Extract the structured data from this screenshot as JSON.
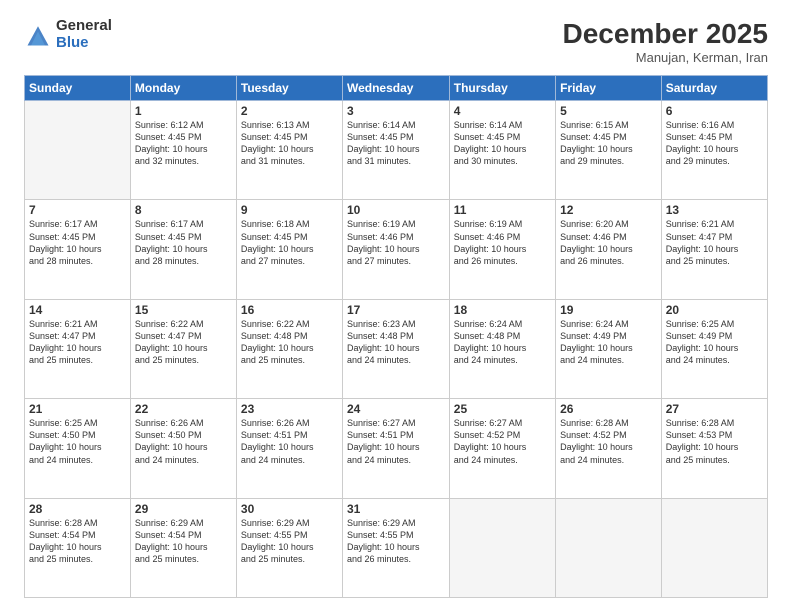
{
  "header": {
    "logo_general": "General",
    "logo_blue": "Blue",
    "month_year": "December 2025",
    "location": "Manujan, Kerman, Iran"
  },
  "days_of_week": [
    "Sunday",
    "Monday",
    "Tuesday",
    "Wednesday",
    "Thursday",
    "Friday",
    "Saturday"
  ],
  "weeks": [
    [
      {
        "num": "",
        "info": ""
      },
      {
        "num": "1",
        "info": "Sunrise: 6:12 AM\nSunset: 4:45 PM\nDaylight: 10 hours\nand 32 minutes."
      },
      {
        "num": "2",
        "info": "Sunrise: 6:13 AM\nSunset: 4:45 PM\nDaylight: 10 hours\nand 31 minutes."
      },
      {
        "num": "3",
        "info": "Sunrise: 6:14 AM\nSunset: 4:45 PM\nDaylight: 10 hours\nand 31 minutes."
      },
      {
        "num": "4",
        "info": "Sunrise: 6:14 AM\nSunset: 4:45 PM\nDaylight: 10 hours\nand 30 minutes."
      },
      {
        "num": "5",
        "info": "Sunrise: 6:15 AM\nSunset: 4:45 PM\nDaylight: 10 hours\nand 29 minutes."
      },
      {
        "num": "6",
        "info": "Sunrise: 6:16 AM\nSunset: 4:45 PM\nDaylight: 10 hours\nand 29 minutes."
      }
    ],
    [
      {
        "num": "7",
        "info": "Sunrise: 6:17 AM\nSunset: 4:45 PM\nDaylight: 10 hours\nand 28 minutes."
      },
      {
        "num": "8",
        "info": "Sunrise: 6:17 AM\nSunset: 4:45 PM\nDaylight: 10 hours\nand 28 minutes."
      },
      {
        "num": "9",
        "info": "Sunrise: 6:18 AM\nSunset: 4:45 PM\nDaylight: 10 hours\nand 27 minutes."
      },
      {
        "num": "10",
        "info": "Sunrise: 6:19 AM\nSunset: 4:46 PM\nDaylight: 10 hours\nand 27 minutes."
      },
      {
        "num": "11",
        "info": "Sunrise: 6:19 AM\nSunset: 4:46 PM\nDaylight: 10 hours\nand 26 minutes."
      },
      {
        "num": "12",
        "info": "Sunrise: 6:20 AM\nSunset: 4:46 PM\nDaylight: 10 hours\nand 26 minutes."
      },
      {
        "num": "13",
        "info": "Sunrise: 6:21 AM\nSunset: 4:47 PM\nDaylight: 10 hours\nand 25 minutes."
      }
    ],
    [
      {
        "num": "14",
        "info": "Sunrise: 6:21 AM\nSunset: 4:47 PM\nDaylight: 10 hours\nand 25 minutes."
      },
      {
        "num": "15",
        "info": "Sunrise: 6:22 AM\nSunset: 4:47 PM\nDaylight: 10 hours\nand 25 minutes."
      },
      {
        "num": "16",
        "info": "Sunrise: 6:22 AM\nSunset: 4:48 PM\nDaylight: 10 hours\nand 25 minutes."
      },
      {
        "num": "17",
        "info": "Sunrise: 6:23 AM\nSunset: 4:48 PM\nDaylight: 10 hours\nand 24 minutes."
      },
      {
        "num": "18",
        "info": "Sunrise: 6:24 AM\nSunset: 4:48 PM\nDaylight: 10 hours\nand 24 minutes."
      },
      {
        "num": "19",
        "info": "Sunrise: 6:24 AM\nSunset: 4:49 PM\nDaylight: 10 hours\nand 24 minutes."
      },
      {
        "num": "20",
        "info": "Sunrise: 6:25 AM\nSunset: 4:49 PM\nDaylight: 10 hours\nand 24 minutes."
      }
    ],
    [
      {
        "num": "21",
        "info": "Sunrise: 6:25 AM\nSunset: 4:50 PM\nDaylight: 10 hours\nand 24 minutes."
      },
      {
        "num": "22",
        "info": "Sunrise: 6:26 AM\nSunset: 4:50 PM\nDaylight: 10 hours\nand 24 minutes."
      },
      {
        "num": "23",
        "info": "Sunrise: 6:26 AM\nSunset: 4:51 PM\nDaylight: 10 hours\nand 24 minutes."
      },
      {
        "num": "24",
        "info": "Sunrise: 6:27 AM\nSunset: 4:51 PM\nDaylight: 10 hours\nand 24 minutes."
      },
      {
        "num": "25",
        "info": "Sunrise: 6:27 AM\nSunset: 4:52 PM\nDaylight: 10 hours\nand 24 minutes."
      },
      {
        "num": "26",
        "info": "Sunrise: 6:28 AM\nSunset: 4:52 PM\nDaylight: 10 hours\nand 24 minutes."
      },
      {
        "num": "27",
        "info": "Sunrise: 6:28 AM\nSunset: 4:53 PM\nDaylight: 10 hours\nand 25 minutes."
      }
    ],
    [
      {
        "num": "28",
        "info": "Sunrise: 6:28 AM\nSunset: 4:54 PM\nDaylight: 10 hours\nand 25 minutes."
      },
      {
        "num": "29",
        "info": "Sunrise: 6:29 AM\nSunset: 4:54 PM\nDaylight: 10 hours\nand 25 minutes."
      },
      {
        "num": "30",
        "info": "Sunrise: 6:29 AM\nSunset: 4:55 PM\nDaylight: 10 hours\nand 25 minutes."
      },
      {
        "num": "31",
        "info": "Sunrise: 6:29 AM\nSunset: 4:55 PM\nDaylight: 10 hours\nand 26 minutes."
      },
      {
        "num": "",
        "info": ""
      },
      {
        "num": "",
        "info": ""
      },
      {
        "num": "",
        "info": ""
      }
    ]
  ]
}
